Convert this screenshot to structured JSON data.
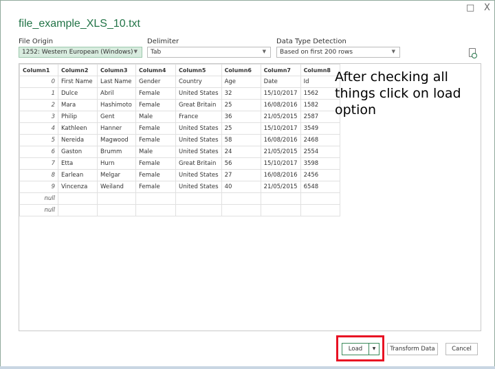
{
  "window": {
    "title": "file_example_XLS_10.txt",
    "maximize_icon": "□",
    "close_icon": "X"
  },
  "options": {
    "file_origin": {
      "label": "File Origin",
      "value": "1252: Western European (Windows)"
    },
    "delimiter": {
      "label": "Delimiter",
      "value": "Tab"
    },
    "detection": {
      "label": "Data Type Detection",
      "value": "Based on first 200 rows"
    }
  },
  "table": {
    "headers": [
      "Column1",
      "Column2",
      "Column3",
      "Column4",
      "Column5",
      "Column6",
      "Column7",
      "Column8"
    ],
    "rows": [
      [
        "0",
        "First Name",
        "Last Name",
        "Gender",
        "Country",
        "Age",
        "Date",
        "Id"
      ],
      [
        "1",
        "Dulce",
        "Abril",
        "Female",
        "United States",
        "32",
        "15/10/2017",
        "1562"
      ],
      [
        "2",
        "Mara",
        "Hashimoto",
        "Female",
        "Great Britain",
        "25",
        "16/08/2016",
        "1582"
      ],
      [
        "3",
        "Philip",
        "Gent",
        "Male",
        "France",
        "36",
        "21/05/2015",
        "2587"
      ],
      [
        "4",
        "Kathleen",
        "Hanner",
        "Female",
        "United States",
        "25",
        "15/10/2017",
        "3549"
      ],
      [
        "5",
        "Nereida",
        "Magwood",
        "Female",
        "United States",
        "58",
        "16/08/2016",
        "2468"
      ],
      [
        "6",
        "Gaston",
        "Brumm",
        "Male",
        "United States",
        "24",
        "21/05/2015",
        "2554"
      ],
      [
        "7",
        "Etta",
        "Hurn",
        "Female",
        "Great Britain",
        "56",
        "15/10/2017",
        "3598"
      ],
      [
        "8",
        "Earlean",
        "Melgar",
        "Female",
        "United States",
        "27",
        "16/08/2016",
        "2456"
      ],
      [
        "9",
        "Vincenza",
        "Weiland",
        "Female",
        "United States",
        "40",
        "21/05/2015",
        "6548"
      ],
      [
        "null",
        "",
        "",
        "",
        "",
        "",
        "",
        ""
      ],
      [
        "null",
        "",
        "",
        "",
        "",
        "",
        "",
        ""
      ]
    ]
  },
  "annotation": "After checking all things click on load option",
  "buttons": {
    "load": "Load",
    "transform": "Transform Data",
    "cancel": "Cancel"
  }
}
